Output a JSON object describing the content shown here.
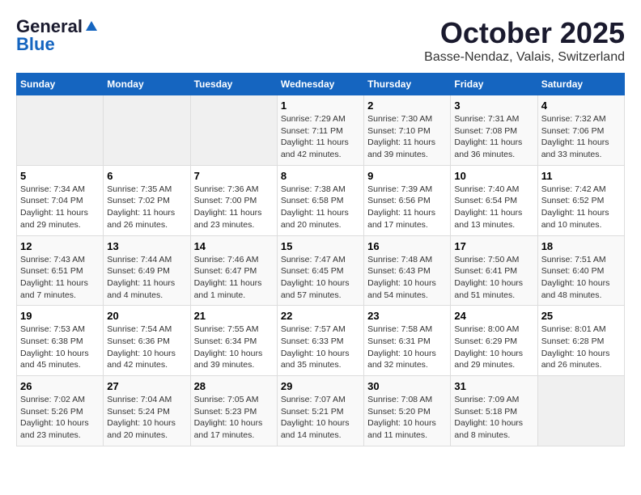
{
  "header": {
    "logo_general": "General",
    "logo_blue": "Blue",
    "title": "October 2025",
    "subtitle": "Basse-Nendaz, Valais, Switzerland"
  },
  "weekdays": [
    "Sunday",
    "Monday",
    "Tuesday",
    "Wednesday",
    "Thursday",
    "Friday",
    "Saturday"
  ],
  "weeks": [
    [
      {
        "day": "",
        "info": ""
      },
      {
        "day": "",
        "info": ""
      },
      {
        "day": "",
        "info": ""
      },
      {
        "day": "1",
        "info": "Sunrise: 7:29 AM\nSunset: 7:11 PM\nDaylight: 11 hours\nand 42 minutes."
      },
      {
        "day": "2",
        "info": "Sunrise: 7:30 AM\nSunset: 7:10 PM\nDaylight: 11 hours\nand 39 minutes."
      },
      {
        "day": "3",
        "info": "Sunrise: 7:31 AM\nSunset: 7:08 PM\nDaylight: 11 hours\nand 36 minutes."
      },
      {
        "day": "4",
        "info": "Sunrise: 7:32 AM\nSunset: 7:06 PM\nDaylight: 11 hours\nand 33 minutes."
      }
    ],
    [
      {
        "day": "5",
        "info": "Sunrise: 7:34 AM\nSunset: 7:04 PM\nDaylight: 11 hours\nand 29 minutes."
      },
      {
        "day": "6",
        "info": "Sunrise: 7:35 AM\nSunset: 7:02 PM\nDaylight: 11 hours\nand 26 minutes."
      },
      {
        "day": "7",
        "info": "Sunrise: 7:36 AM\nSunset: 7:00 PM\nDaylight: 11 hours\nand 23 minutes."
      },
      {
        "day": "8",
        "info": "Sunrise: 7:38 AM\nSunset: 6:58 PM\nDaylight: 11 hours\nand 20 minutes."
      },
      {
        "day": "9",
        "info": "Sunrise: 7:39 AM\nSunset: 6:56 PM\nDaylight: 11 hours\nand 17 minutes."
      },
      {
        "day": "10",
        "info": "Sunrise: 7:40 AM\nSunset: 6:54 PM\nDaylight: 11 hours\nand 13 minutes."
      },
      {
        "day": "11",
        "info": "Sunrise: 7:42 AM\nSunset: 6:52 PM\nDaylight: 11 hours\nand 10 minutes."
      }
    ],
    [
      {
        "day": "12",
        "info": "Sunrise: 7:43 AM\nSunset: 6:51 PM\nDaylight: 11 hours\nand 7 minutes."
      },
      {
        "day": "13",
        "info": "Sunrise: 7:44 AM\nSunset: 6:49 PM\nDaylight: 11 hours\nand 4 minutes."
      },
      {
        "day": "14",
        "info": "Sunrise: 7:46 AM\nSunset: 6:47 PM\nDaylight: 11 hours\nand 1 minute."
      },
      {
        "day": "15",
        "info": "Sunrise: 7:47 AM\nSunset: 6:45 PM\nDaylight: 10 hours\nand 57 minutes."
      },
      {
        "day": "16",
        "info": "Sunrise: 7:48 AM\nSunset: 6:43 PM\nDaylight: 10 hours\nand 54 minutes."
      },
      {
        "day": "17",
        "info": "Sunrise: 7:50 AM\nSunset: 6:41 PM\nDaylight: 10 hours\nand 51 minutes."
      },
      {
        "day": "18",
        "info": "Sunrise: 7:51 AM\nSunset: 6:40 PM\nDaylight: 10 hours\nand 48 minutes."
      }
    ],
    [
      {
        "day": "19",
        "info": "Sunrise: 7:53 AM\nSunset: 6:38 PM\nDaylight: 10 hours\nand 45 minutes."
      },
      {
        "day": "20",
        "info": "Sunrise: 7:54 AM\nSunset: 6:36 PM\nDaylight: 10 hours\nand 42 minutes."
      },
      {
        "day": "21",
        "info": "Sunrise: 7:55 AM\nSunset: 6:34 PM\nDaylight: 10 hours\nand 39 minutes."
      },
      {
        "day": "22",
        "info": "Sunrise: 7:57 AM\nSunset: 6:33 PM\nDaylight: 10 hours\nand 35 minutes."
      },
      {
        "day": "23",
        "info": "Sunrise: 7:58 AM\nSunset: 6:31 PM\nDaylight: 10 hours\nand 32 minutes."
      },
      {
        "day": "24",
        "info": "Sunrise: 8:00 AM\nSunset: 6:29 PM\nDaylight: 10 hours\nand 29 minutes."
      },
      {
        "day": "25",
        "info": "Sunrise: 8:01 AM\nSunset: 6:28 PM\nDaylight: 10 hours\nand 26 minutes."
      }
    ],
    [
      {
        "day": "26",
        "info": "Sunrise: 7:02 AM\nSunset: 5:26 PM\nDaylight: 10 hours\nand 23 minutes."
      },
      {
        "day": "27",
        "info": "Sunrise: 7:04 AM\nSunset: 5:24 PM\nDaylight: 10 hours\nand 20 minutes."
      },
      {
        "day": "28",
        "info": "Sunrise: 7:05 AM\nSunset: 5:23 PM\nDaylight: 10 hours\nand 17 minutes."
      },
      {
        "day": "29",
        "info": "Sunrise: 7:07 AM\nSunset: 5:21 PM\nDaylight: 10 hours\nand 14 minutes."
      },
      {
        "day": "30",
        "info": "Sunrise: 7:08 AM\nSunset: 5:20 PM\nDaylight: 10 hours\nand 11 minutes."
      },
      {
        "day": "31",
        "info": "Sunrise: 7:09 AM\nSunset: 5:18 PM\nDaylight: 10 hours\nand 8 minutes."
      },
      {
        "day": "",
        "info": ""
      }
    ]
  ]
}
